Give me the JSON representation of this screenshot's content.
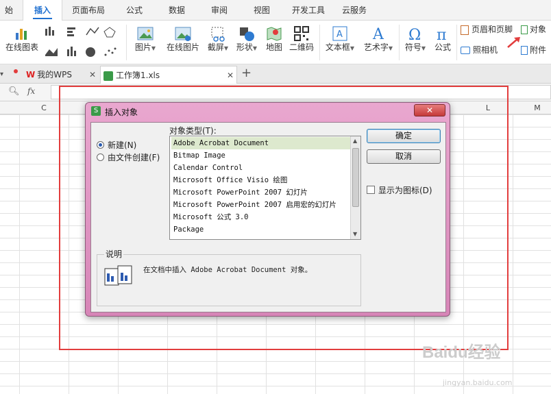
{
  "menu_tabs": [
    "始",
    "插入",
    "页面布局",
    "公式",
    "数据",
    "审阅",
    "视图",
    "开发工具",
    "云服务"
  ],
  "ribbon": {
    "buttons": {
      "online_chart": "在线图表",
      "picture": "图片",
      "online_picture": "在线图片",
      "screenshot": "截屏",
      "shape": "形状",
      "map": "地图",
      "qrcode": "二维码",
      "textbox": "文本框",
      "wordart": "艺术字",
      "symbol": "符号",
      "formula": "公式",
      "header_footer": "页眉和页脚",
      "camera": "照相机",
      "object": "对象",
      "attachment": "附件"
    }
  },
  "doc_tabs": {
    "wps": "我的WPS",
    "workbook": "工作簿1.xls"
  },
  "formula_bar": {
    "fx": "fx"
  },
  "columns": [
    "C",
    "L",
    "M"
  ],
  "dialog": {
    "title": "插入对象",
    "close": "✕",
    "radio_new": "新建(N)",
    "radio_from_file": "由文件创建(F)",
    "object_type_label": "对象类型(T):",
    "object_types": [
      "Adobe Acrobat Document",
      "Bitmap Image",
      "Calendar Control",
      "Microsoft Office Visio 绘图",
      "Microsoft PowerPoint 2007 幻灯片",
      "Microsoft PowerPoint 2007 启用宏的幻灯片",
      "Microsoft 公式 3.0",
      "Package"
    ],
    "ok": "确定",
    "cancel": "取消",
    "display_as_icon": "显示为图标(D)",
    "description_label": "说明",
    "description": "在文档中插入 Adobe Acrobat Document 对象。"
  },
  "watermark": {
    "text": "Baidu经验",
    "url": "jingyan.baidu.com"
  }
}
